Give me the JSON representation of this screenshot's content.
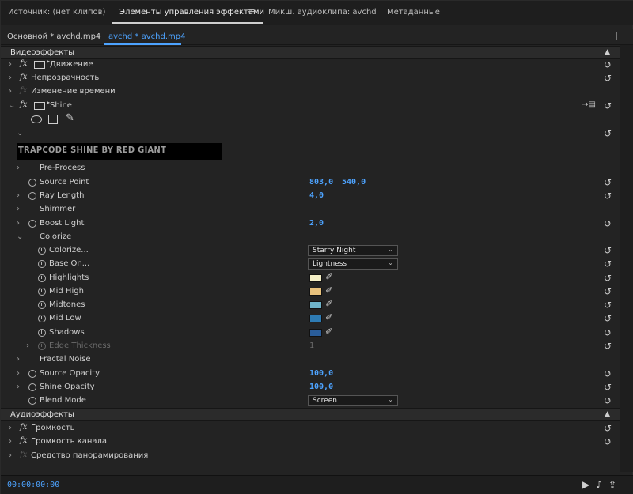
{
  "tabs": [
    {
      "label": "Источник: (нет клипов)"
    },
    {
      "label": "Элементы управления эффектами",
      "active": true
    },
    {
      "label": "Микш. аудиоклипа: avchd"
    },
    {
      "label": "Метаданные"
    }
  ],
  "tab_menu_icon": "hamburger-icon",
  "clip": {
    "master": "Основной * avchd.mp4",
    "sequence": "avchd * avchd.mp4"
  },
  "video_section": "Видеоэффекты",
  "effects": {
    "motion": "Движение",
    "opacity": "Непрозрачность",
    "time_remap": "Изменение времени",
    "shine": "Shine"
  },
  "shine_banner": "TRAPCODE SHINE BY RED GIANT",
  "shine": {
    "pre_process": "Pre-Process",
    "source_point": {
      "label": "Source Point",
      "x": "803,0",
      "y": "540,0"
    },
    "ray_length": {
      "label": "Ray Length",
      "value": "4,0"
    },
    "shimmer": "Shimmer",
    "boost_light": {
      "label": "Boost Light",
      "value": "2,0"
    },
    "colorize_group": "Colorize",
    "colorize": {
      "label": "Colorize...",
      "value": "Starry Night"
    },
    "base_on": {
      "label": "Base On...",
      "value": "Lightness"
    },
    "colors": [
      {
        "label": "Highlights",
        "color": "#f4efc6"
      },
      {
        "label": "Mid High",
        "color": "#e8c27d"
      },
      {
        "label": "Midtones",
        "color": "#6fb3c9"
      },
      {
        "label": "Mid Low",
        "color": "#2e7bb3"
      },
      {
        "label": "Shadows",
        "color": "#2a5d9a"
      }
    ],
    "edge_thickness": {
      "label": "Edge Thickness",
      "value": "1"
    },
    "fractal_noise": "Fractal Noise",
    "source_opacity": {
      "label": "Source Opacity",
      "value": "100,0"
    },
    "shine_opacity": {
      "label": "Shine Opacity",
      "value": "100,0"
    },
    "blend_mode": {
      "label": "Blend Mode",
      "value": "Screen"
    }
  },
  "audio_section": "Аудиоэффекты",
  "audio_effects": {
    "volume": "Громкость",
    "channel_volume": "Громкость канала",
    "panner": "Средство панорамирования"
  },
  "footer": {
    "timecode": "00:00:00:00",
    "icons": [
      "play-audio-icon",
      "export-icon"
    ]
  },
  "colors": {
    "accent": "#4da3ff",
    "bg": "#232323",
    "section_bg": "#2b2b2b"
  }
}
